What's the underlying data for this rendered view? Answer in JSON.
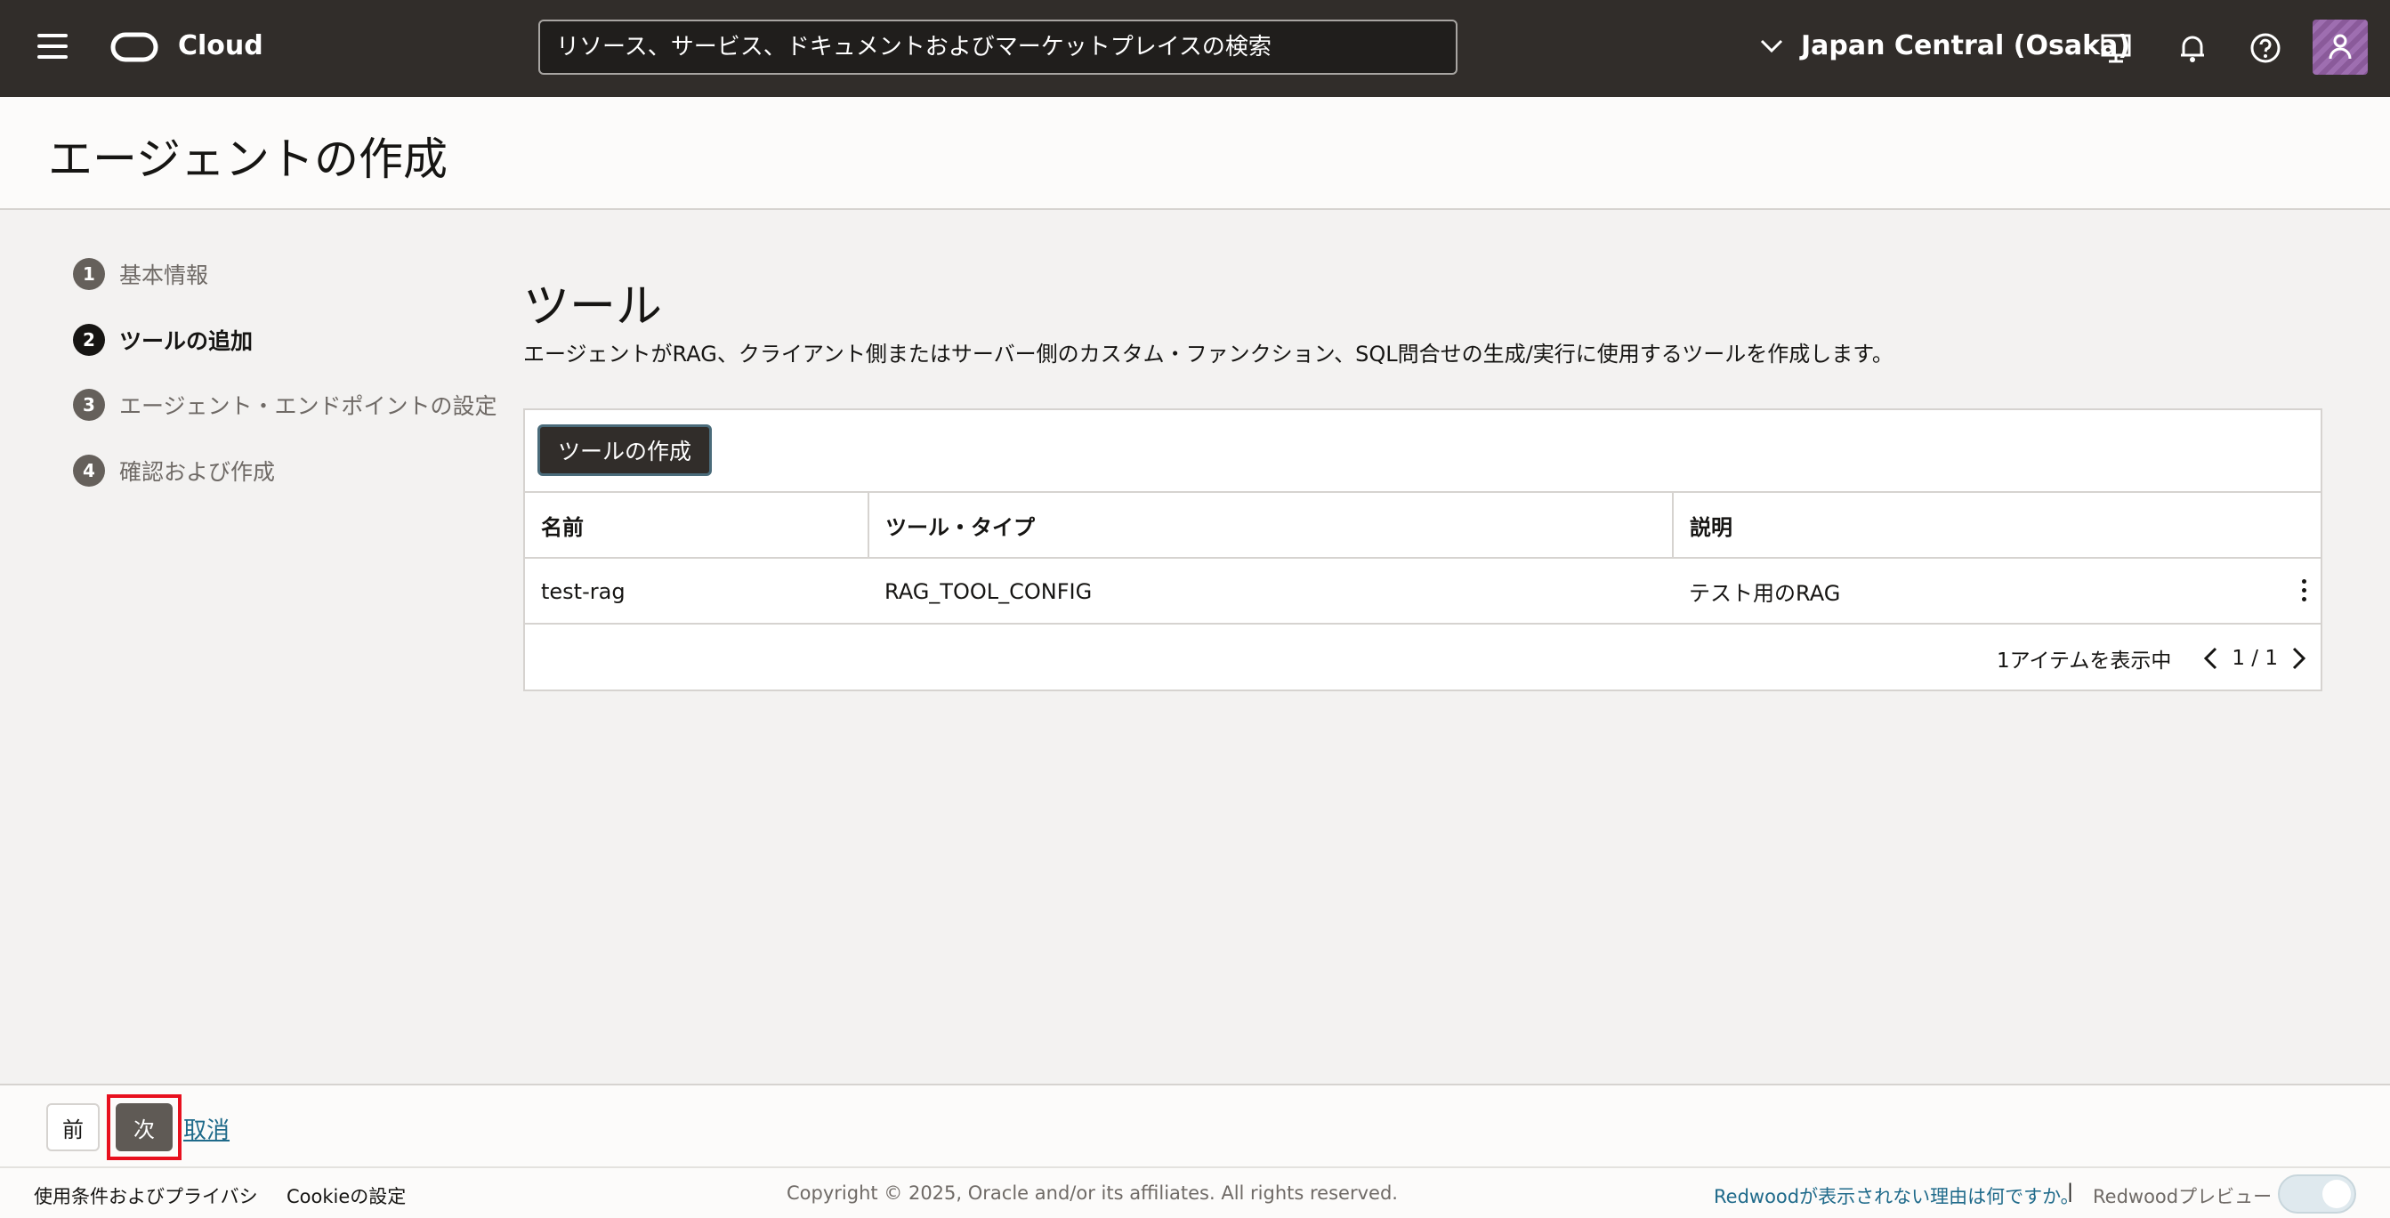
{
  "header": {
    "brand": "Cloud",
    "search_placeholder": "リソース、サービス、ドキュメントおよびマーケットプレイスの検索",
    "region": "Japan Central (Osaka)"
  },
  "page": {
    "title": "エージェントの作成"
  },
  "steps": [
    {
      "num": "1",
      "label": "基本情報"
    },
    {
      "num": "2",
      "label": "ツールの追加"
    },
    {
      "num": "3",
      "label": "エージェント・エンドポイントの設定"
    },
    {
      "num": "4",
      "label": "確認および作成"
    }
  ],
  "main": {
    "title": "ツール",
    "description": "エージェントがRAG、クライアント側またはサーバー側のカスタム・ファンクション、SQL問合せの生成/実行に使用するツールを作成します。",
    "create_button": "ツールの作成",
    "columns": [
      "名前",
      "ツール・タイプ",
      "説明"
    ],
    "rows": [
      {
        "name": "test-rag",
        "type": "RAG_TOOL_CONFIG",
        "description": "テスト用のRAG"
      }
    ],
    "pager": {
      "count": "1アイテムを表示中",
      "page": "1 / 1"
    }
  },
  "actions": {
    "prev": "前",
    "next": "次",
    "cancel": "取消"
  },
  "footer": {
    "terms": "使用条件およびプライバシ",
    "cookie": "Cookieの設定",
    "copyright": "Copyright © 2025, Oracle and/or its affiliates. All rights reserved.",
    "why_redwood": "Redwoodが表示されない理由は何ですか。",
    "separator": "|",
    "preview": "Redwoodプレビュー"
  },
  "colors": {
    "header_bg": "#312d2a",
    "highlight": "#e8101e",
    "link": "#1f6a8a"
  }
}
